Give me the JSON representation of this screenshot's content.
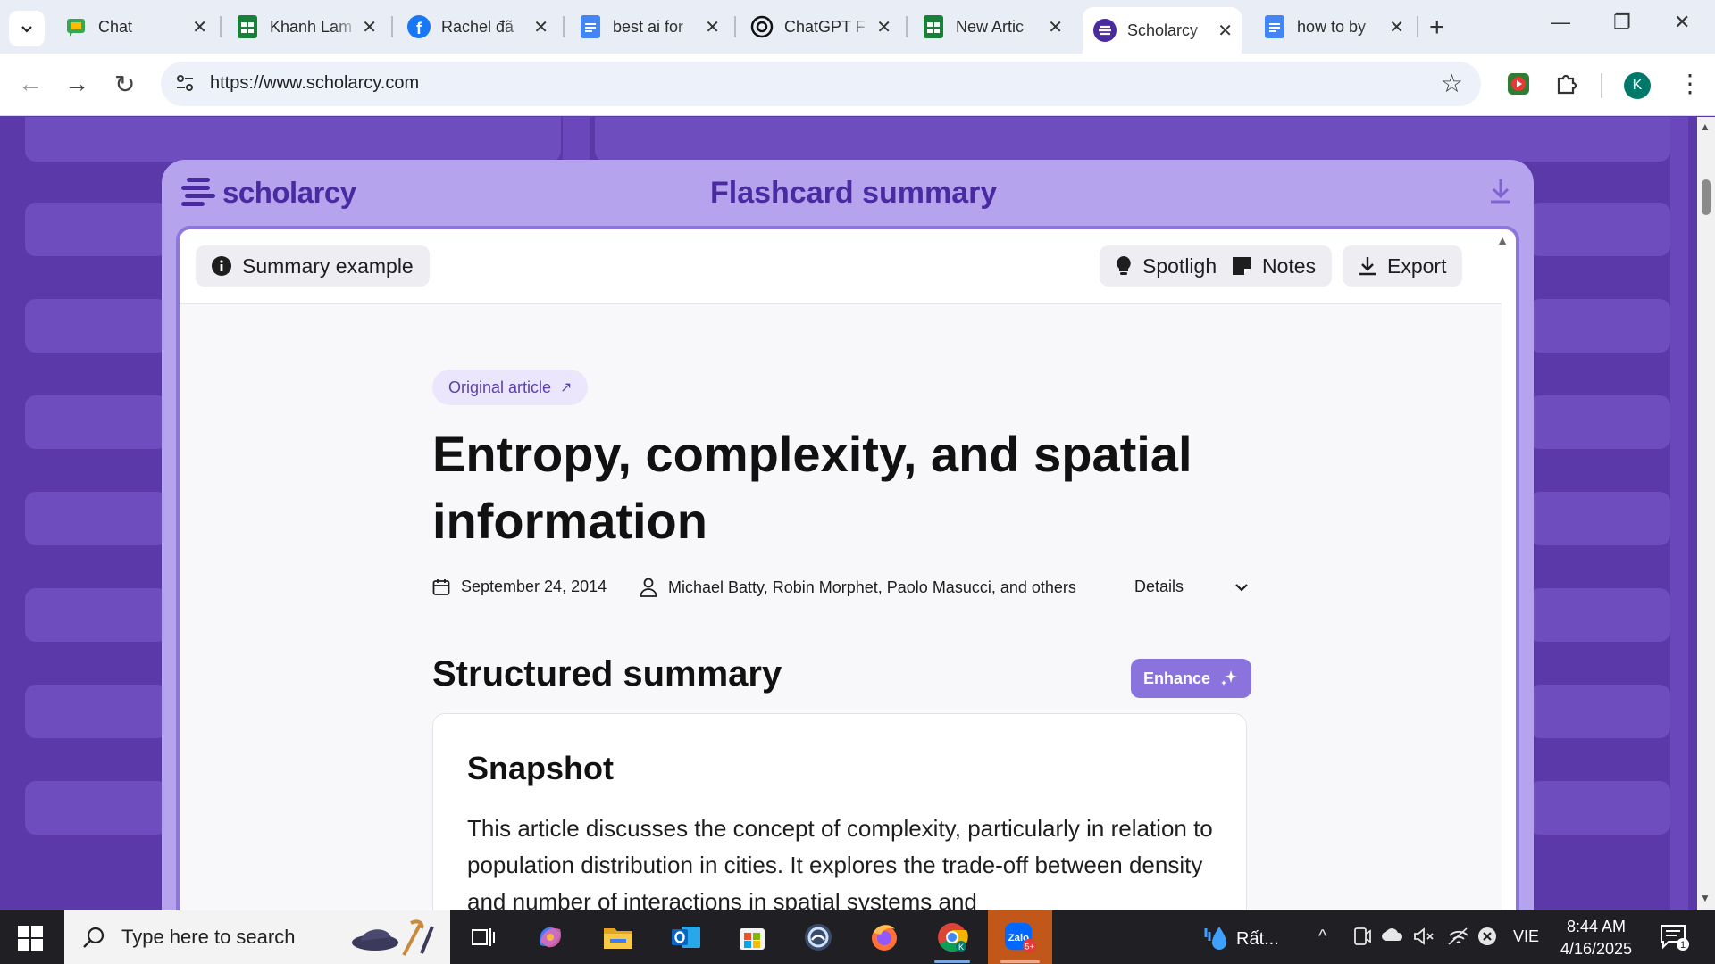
{
  "browser": {
    "tabs": [
      {
        "title": "Chat",
        "icon": "google-chat-icon"
      },
      {
        "title": "Khanh Lam",
        "icon": "google-sheets-icon"
      },
      {
        "title": "Rachel đã",
        "icon": "facebook-icon"
      },
      {
        "title": "best ai for",
        "icon": "google-docs-icon"
      },
      {
        "title": "ChatGPT F",
        "icon": "chatgpt-icon"
      },
      {
        "title": "New Artic",
        "icon": "google-sheets-icon"
      },
      {
        "title": "Scholarcy",
        "icon": "scholarcy-icon",
        "active": true
      },
      {
        "title": "how to by",
        "icon": "google-docs-icon"
      }
    ],
    "url": "https://www.scholarcy.com",
    "profile_initial": "K"
  },
  "page": {
    "logo_text": "scholarcy",
    "card_title": "Flashcard summary",
    "toolbar": {
      "summary_example": "Summary example",
      "spotlight": "Spotlight",
      "notes": "Notes",
      "export": "Export"
    },
    "original_article": "Original article",
    "article_title": "Entropy, complexity, and spatial information",
    "date": "September 24, 2014",
    "authors": "Michael Batty, Robin Morphet, Paolo Masucci, and others",
    "details": "Details",
    "structured_summary": "Structured summary",
    "enhance": "Enhance",
    "snapshot_title": "Snapshot",
    "snapshot_body": "This article discusses the concept of complexity, particularly in relation to population distribution in cities. It explores the trade-off between density and number of interactions in spatial systems and"
  },
  "taskbar": {
    "search_placeholder": "Type here to search",
    "weather_text": "Rất...",
    "language": "VIE",
    "time": "8:44 AM",
    "date": "4/16/2025",
    "zalo_badge": "5+",
    "notification_count": "1"
  },
  "colors": {
    "brand_purple": "#4a2aa0",
    "card_lavender": "#b5a4ed",
    "page_bg": "#5b39a8",
    "enhance_bg": "#8b73de"
  }
}
